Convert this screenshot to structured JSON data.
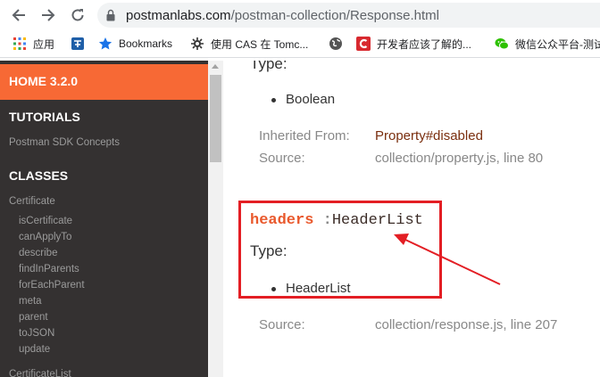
{
  "browser": {
    "url_host": "postmanlabs.com",
    "url_path": "/postman-collection/Response.html",
    "bookmarks": [
      {
        "label": "应用",
        "icon": "apps-grid-icon"
      },
      {
        "label": "",
        "icon": "bookmark-app-icon"
      },
      {
        "label": "Bookmarks",
        "icon": "star-icon"
      },
      {
        "label": "使用 CAS 在 Tomc...",
        "icon": "cas-icon"
      },
      {
        "label": "",
        "icon": "globe-icon"
      },
      {
        "label": "开发者应该了解的...",
        "icon": "csdn-icon"
      },
      {
        "label": "微信公众平台-测试",
        "icon": "wechat-icon"
      }
    ]
  },
  "sidebar": {
    "home": "HOME 3.2.0",
    "tutorials_heading": "TUTORIALS",
    "tutorial_link": "Postman SDK Concepts",
    "classes_heading": "CLASSES",
    "class_name": "Certificate",
    "members": [
      "isCertificate",
      "canApplyTo",
      "describe",
      "findInParents",
      "forEachParent",
      "meta",
      "parent",
      "toJSON",
      "update"
    ],
    "next_class_partial": "CertificateList"
  },
  "main": {
    "prev_type_heading": "Type:",
    "prev_type_value": "Boolean",
    "inherited_label": "Inherited From:",
    "inherited_value": "Property#disabled",
    "source_label": "Source:",
    "prev_source": "collection/property.js, line 80",
    "member_name": "headers",
    "member_sep": " :",
    "member_type": "HeaderList",
    "type_heading": "Type:",
    "type_value": "HeaderList",
    "source_label2": "Source:",
    "member_source": "collection/response.js, line 207"
  },
  "colors": {
    "annotation": "#e31e24",
    "accent": "#f76935",
    "sidebar_bg": "#343131"
  }
}
